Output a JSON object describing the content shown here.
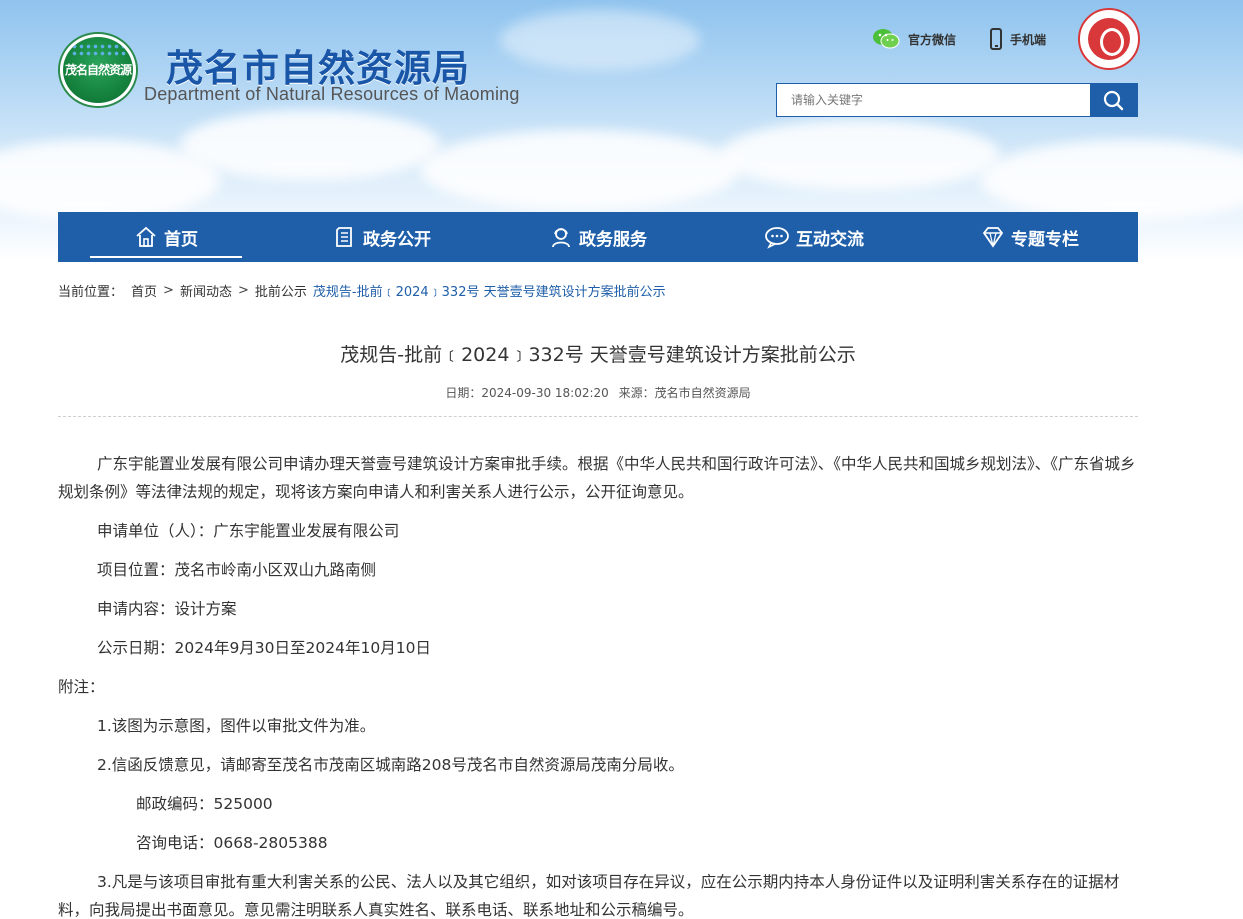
{
  "header": {
    "logo_text": "茂名自然资源",
    "title": "茂名市自然资源局",
    "subtitle": "Department of Natural Resources of Maoming",
    "links": [
      {
        "label": "官方微信",
        "icon": "wechat-icon"
      },
      {
        "label": "手机端",
        "icon": "mobile-phone-icon"
      }
    ],
    "seal_icon": "city-seal-icon"
  },
  "search": {
    "placeholder": "请输入关键字",
    "icon": "search-icon"
  },
  "nav": [
    {
      "label": "首页",
      "icon": "home-icon",
      "active": true
    },
    {
      "label": "政务公开",
      "icon": "document-icon"
    },
    {
      "label": "政务服务",
      "icon": "service-person-icon"
    },
    {
      "label": "互动交流",
      "icon": "chat-icon"
    },
    {
      "label": "专题专栏",
      "icon": "diamond-icon"
    }
  ],
  "breadcrumb": {
    "prefix": "当前位置：",
    "items": [
      "首页",
      "新闻动态",
      "批前公示"
    ],
    "current": "茂规告-批前﹝2024﹞332号 天誉壹号建筑设计方案批前公示"
  },
  "article": {
    "title": "茂规告-批前﹝2024﹞332号 天誉壹号建筑设计方案批前公示",
    "date": "日期：2024-09-30 18:02:20",
    "source": "来源：茂名市自然资源局",
    "intro": "广东宇能置业发展有限公司申请办理天誉壹号建筑设计方案审批手续。根据《中华人民共和国行政许可法》、《中华人民共和国城乡规划法》、《广东省城乡规划条例》等法律法规的规定，现将该方案向申请人和利害关系人进行公示，公开征询意见。",
    "applicant": "申请单位（人）：广东宇能置业发展有限公司",
    "location": "项目位置：茂名市岭南小区双山九路南侧",
    "content": "申请内容：设计方案",
    "period": "公示日期：2024年9月30日至2024年10月10日",
    "notes_label": "附注：",
    "note1": "1.该图为示意图，图件以审批文件为准。",
    "note2": "2.信函反馈意见，请邮寄至茂名市茂南区城南路208号茂名市自然资源局茂南分局收。",
    "postcode": "邮政编码：525000",
    "phone": "咨询电话：0668-2805388",
    "note3": "3.凡是与该项目审批有重大利害关系的公民、法人以及其它组织，如对该项目存在异议，应在公示期内持本人身份证件以及证明利害关系存在的证据材料，向我局提出书面意见。意见需注明联系人真实姓名、联系电话、联系地址和公示稿编号。"
  },
  "colors": {
    "brand_blue": "#1f5faa",
    "title_blue": "#1a56a8",
    "seal_red": "#d8383a"
  }
}
